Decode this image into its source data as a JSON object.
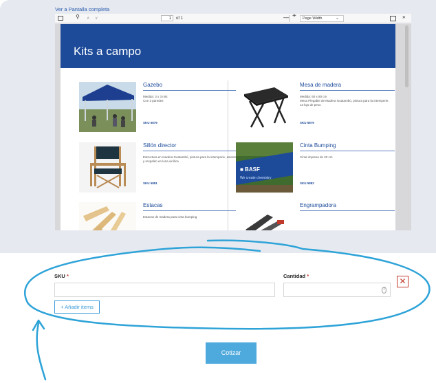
{
  "viewer": {
    "fullscreen_link": "Ver a Pantalla completa",
    "toolbar": {
      "page_current": "1",
      "page_total": "of 1",
      "zoom": "Page Width",
      "minus": "—",
      "plus": "+"
    }
  },
  "document": {
    "title": "Kits a campo",
    "products": [
      {
        "name": "Gazebo",
        "description": "Medida: 3 x 3 mts\nCon 3 paredes",
        "sku": "SKU 5879"
      },
      {
        "name": "Mesa de madera",
        "description": "Medida: 60 x 80 cm\nMesa Plegable de Madera Guatambú, pintura para la intemperie.\n13 kgs de peso",
        "sku": "SKU 5879"
      },
      {
        "name": "Sillón director",
        "description": "Estructura en madera Guatambú, pintura para la intemperie, asiento y respaldo en lona vinílica",
        "sku": "SKU 5881"
      },
      {
        "name": "Cinta Bumping",
        "description": "Cinta impresa de 20 cm",
        "sku": "SKU 5882"
      },
      {
        "name": "Estacas",
        "description": "Estacas de madera para cinta bumping",
        "sku": ""
      },
      {
        "name": "Engrampadora",
        "description": "",
        "sku": ""
      }
    ],
    "banner_text": "■ BASF",
    "banner_slogan": "We create chemistry"
  },
  "form": {
    "sku_label": "SKU",
    "qty_label": "Cantidad",
    "required_mark": "*",
    "sku_value": "",
    "qty_value": "",
    "remove_label": "✕",
    "add_items_label": "+ Añadir items",
    "submit_label": "Cotizar"
  },
  "colors": {
    "brand_blue": "#1d4b9a",
    "button_blue": "#4ea9dc",
    "annotation_blue": "#2ea3d8",
    "danger": "#c0392b"
  }
}
